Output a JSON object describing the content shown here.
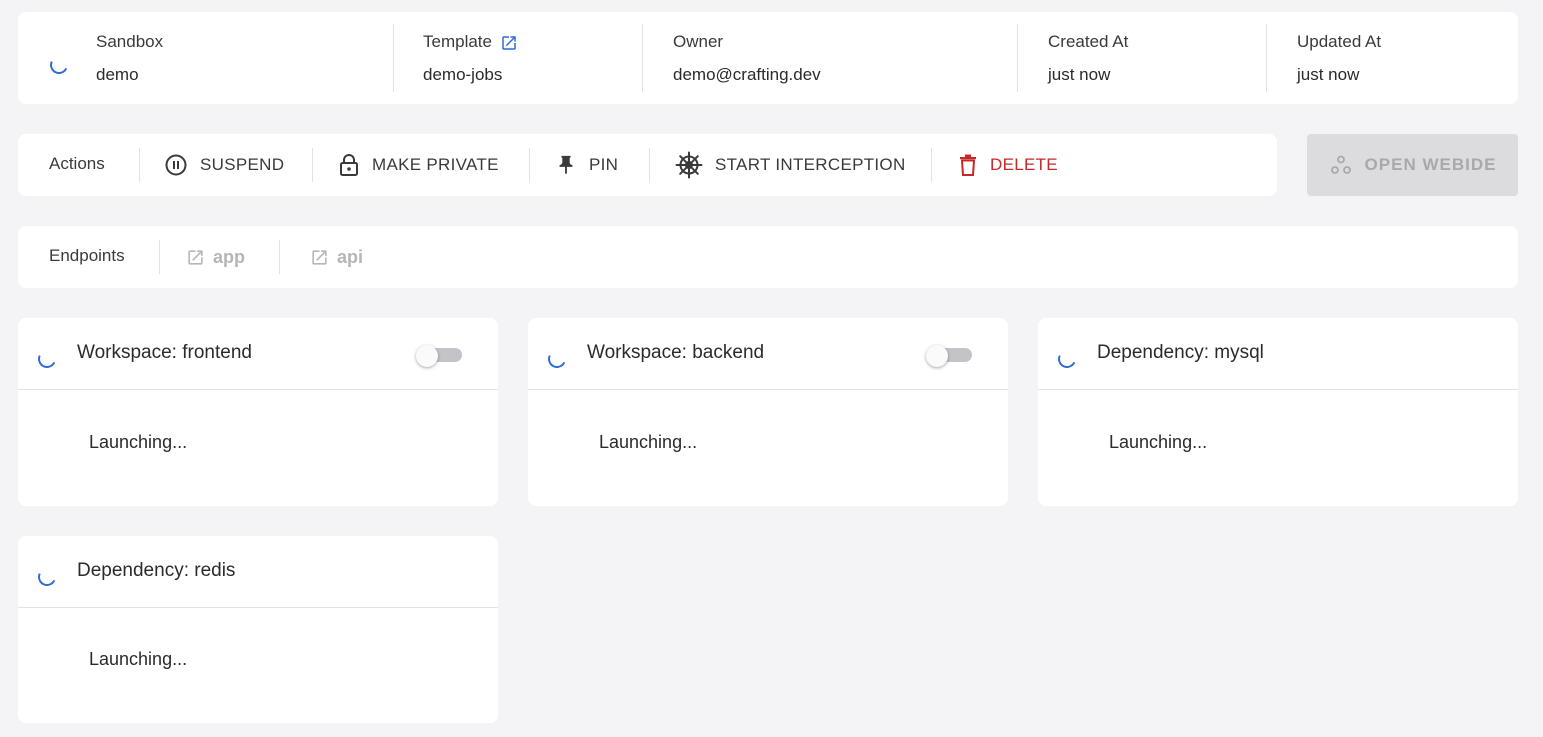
{
  "info": {
    "sandbox": {
      "label": "Sandbox",
      "value": "demo"
    },
    "template": {
      "label": "Template",
      "value": "demo-jobs"
    },
    "owner": {
      "label": "Owner",
      "value": "demo@crafting.dev"
    },
    "created_at": {
      "label": "Created At",
      "value": "just now"
    },
    "updated_at": {
      "label": "Updated At",
      "value": "just now"
    }
  },
  "actions": {
    "label": "Actions",
    "items": [
      {
        "label": "SUSPEND",
        "icon": "pause-circle-icon"
      },
      {
        "label": "MAKE PRIVATE",
        "icon": "lock-icon"
      },
      {
        "label": "PIN",
        "icon": "pin-icon"
      },
      {
        "label": "START INTERCEPTION",
        "icon": "helm-icon"
      },
      {
        "label": "DELETE",
        "icon": "trash-icon"
      }
    ],
    "open_webide": {
      "label": "OPEN WEBIDE",
      "icon": "webide-icon",
      "disabled": true
    }
  },
  "endpoints": {
    "label": "Endpoints",
    "items": [
      {
        "label": "app",
        "icon": "external-link-icon"
      },
      {
        "label": "api",
        "icon": "external-link-icon"
      }
    ]
  },
  "resources": [
    {
      "title": "Workspace: frontend",
      "status": "Launching...",
      "has_toggle": true,
      "toggle_on": false
    },
    {
      "title": "Workspace: backend",
      "status": "Launching...",
      "has_toggle": true,
      "toggle_on": false
    },
    {
      "title": "Dependency: mysql",
      "status": "Launching...",
      "has_toggle": false
    },
    {
      "title": "Dependency: redis",
      "status": "Launching...",
      "has_toggle": false
    }
  ],
  "colors": {
    "accent": "#2e6bd6",
    "danger": "#c62828",
    "disabled": "#a9a9ad",
    "background": "#f4f4f6"
  }
}
